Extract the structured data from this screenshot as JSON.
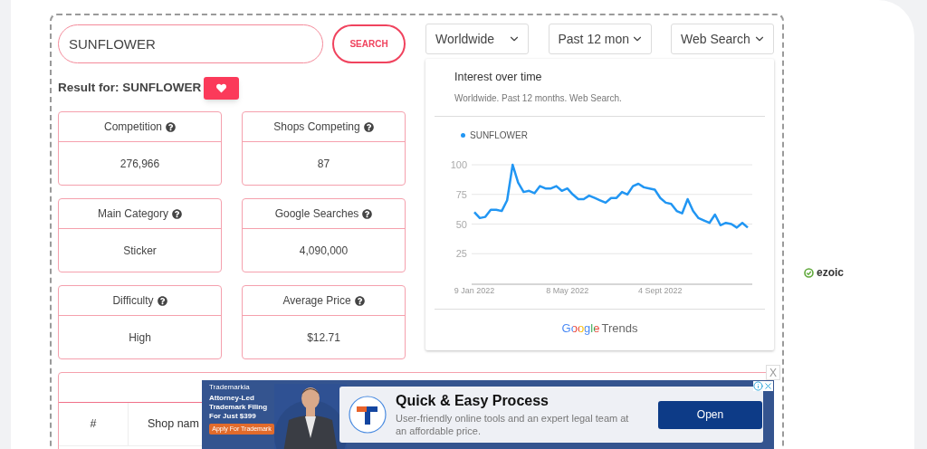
{
  "search": {
    "value": "SUNFLOWER",
    "button": "SEARCH"
  },
  "result": {
    "label": "Result for: SUNFLOWER"
  },
  "stats": [
    {
      "label": "Competition",
      "value": "276,966"
    },
    {
      "label": "Shops Competing",
      "value": "87"
    },
    {
      "label": "Main Category",
      "value": "Sticker"
    },
    {
      "label": "Google Searches",
      "value": "4,090,000"
    },
    {
      "label": "Difficulty",
      "value": "High"
    },
    {
      "label": "Average Price",
      "value": "$12.71"
    }
  ],
  "filters": [
    "Worldwide",
    "Past 12 mon",
    "Web Search"
  ],
  "trends": {
    "title": "Interest over time",
    "subtitle": "Worldwide. Past 12 months. Web Search.",
    "logo_google": "Google",
    "logo_trends": "Trends",
    "chart_data": {
      "type": "line",
      "categories": [
        "9 Jan 2022",
        null,
        null,
        null,
        null,
        null,
        null,
        null,
        null,
        null,
        null,
        null,
        null,
        null,
        null,
        null,
        null,
        "8 May 2022",
        null,
        null,
        null,
        null,
        null,
        null,
        null,
        null,
        null,
        null,
        null,
        null,
        null,
        null,
        null,
        null,
        "4 Sept 2022",
        null,
        null,
        null,
        null,
        null,
        null,
        null,
        null,
        null,
        null,
        null,
        null,
        null,
        null,
        null,
        null
      ],
      "ylim": [
        0,
        100
      ],
      "yticks": [
        25,
        50,
        75,
        100
      ],
      "grid": true,
      "series": [
        {
          "name": "SUNFLOWER",
          "color": "#2196f3",
          "values": [
            60,
            55,
            56,
            62,
            62,
            61,
            70,
            100,
            85,
            77,
            78,
            76,
            82,
            80,
            80,
            82,
            78,
            80,
            75,
            71,
            71,
            74,
            72,
            70,
            68,
            72,
            72,
            77,
            75,
            82,
            84,
            81,
            80,
            79,
            72,
            68,
            67,
            61,
            59,
            71,
            61,
            55,
            53,
            51,
            58,
            49,
            51,
            50,
            47,
            51,
            47
          ]
        }
      ]
    }
  },
  "table": {
    "columns": [
      "#",
      "Shop nam"
    ]
  },
  "ad": {
    "brand": "Trademarkia",
    "promo": "Attorney-Led Trademark Filing For Just $399",
    "promo_button": "Apply For Trademark",
    "headline": "Quick & Easy Process",
    "text": "User-friendly online tools and an expert legal team at an affordable price.",
    "button": "Open",
    "close": "X"
  },
  "ezoic": "ezoic"
}
